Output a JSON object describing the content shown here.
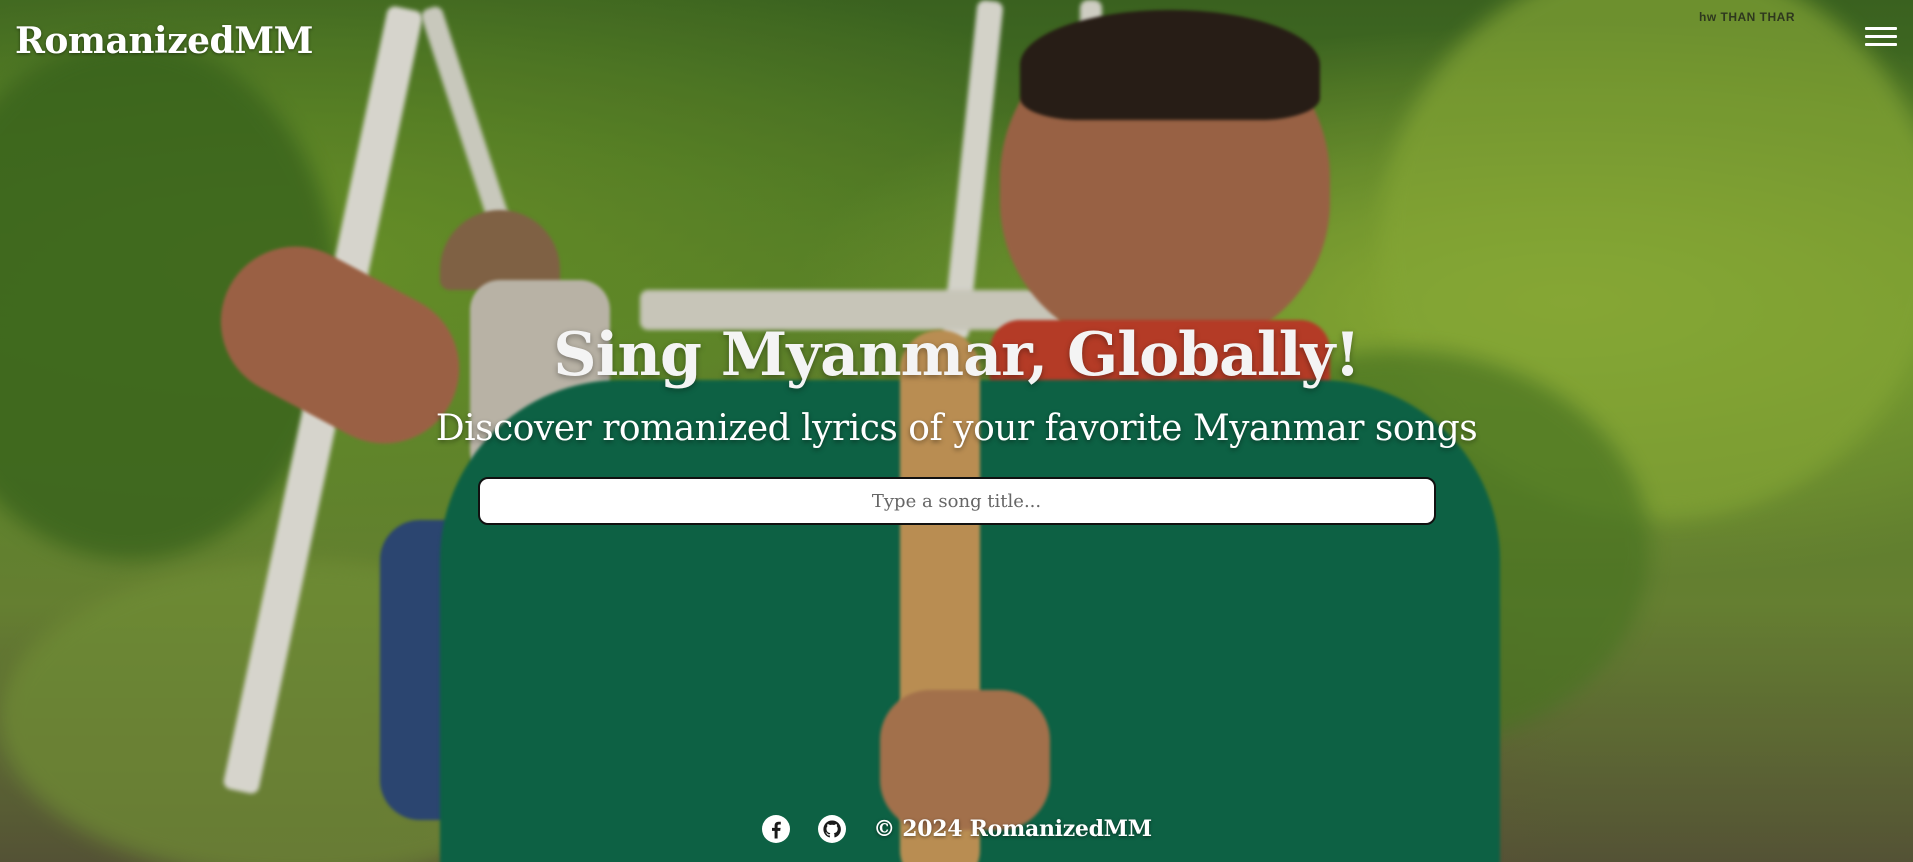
{
  "header": {
    "brand": "RomanizedMM",
    "menu_icon": "hamburger-menu-icon",
    "watermark": "hw THAN THAR"
  },
  "hero": {
    "title": "Sing Myanmar, Globally!",
    "subtitle": "Discover romanized lyrics of your favorite Myanmar songs"
  },
  "search": {
    "value": "",
    "placeholder": "Type a song title..."
  },
  "footer": {
    "icons": [
      "facebook-icon",
      "github-icon"
    ],
    "copyright": "© 2024 RomanizedMM"
  },
  "colors": {
    "text": "#ffffff",
    "input_border": "#111111",
    "input_background": "#ffffff"
  }
}
